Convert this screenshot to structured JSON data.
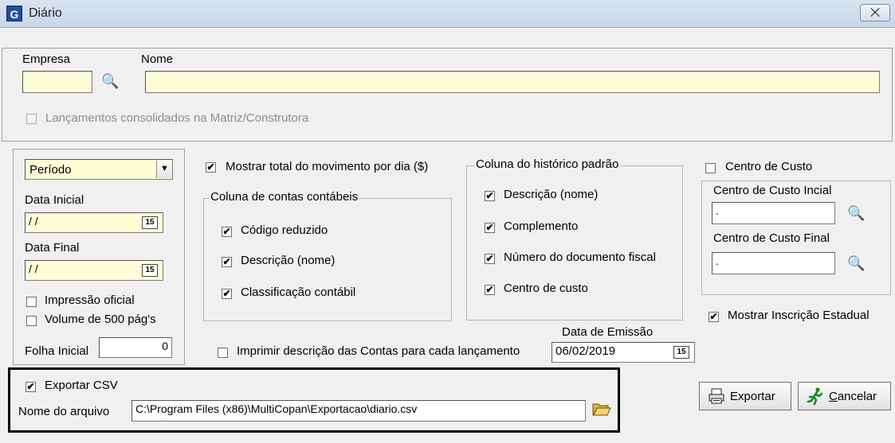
{
  "window": {
    "title": "Diário",
    "close_glyph": "⨉",
    "app_icon": "G"
  },
  "empresa": {
    "label": "Empresa",
    "value": ""
  },
  "nome": {
    "label": "Nome",
    "value": ""
  },
  "consolidados": {
    "label": "Lançamentos consolidados na Matriz/Construtora",
    "checked": false
  },
  "periodo": {
    "selected": "Período",
    "arrow": "▼"
  },
  "data_inicial": {
    "label": "Data Inicial",
    "value": "/ /",
    "cal_icon": "15"
  },
  "data_final": {
    "label": "Data Final",
    "value": "/ /",
    "cal_icon": "15"
  },
  "impressao_oficial": {
    "label": "Impressão oficial",
    "checked": false
  },
  "volume_500": {
    "label": "Volume de 500 pág's",
    "checked": false
  },
  "folha_inicial": {
    "label": "Folha Inicial",
    "value": "0"
  },
  "mostrar_total": {
    "label": "Mostrar total do movimento por dia  ($)",
    "checked": true
  },
  "colunas_contabeis": {
    "legend": "Coluna de contas contábeis",
    "items": [
      {
        "label": "Código reduzido",
        "checked": true
      },
      {
        "label": "Descrição (nome)",
        "checked": true
      },
      {
        "label": "Classificação contábil",
        "checked": true
      }
    ]
  },
  "historico_padrao": {
    "legend": "Coluna do histórico padrão",
    "items": [
      {
        "label": "Descrição (nome)",
        "checked": true
      },
      {
        "label": "Complemento",
        "checked": true
      },
      {
        "label": "Número do documento fiscal",
        "checked": true
      },
      {
        "label": "Centro de custo",
        "checked": true
      }
    ]
  },
  "centro_custo": {
    "label": "Centro de Custo",
    "checked": false,
    "inicial_label": "Centro de Custo Incial",
    "inicial_value": ".",
    "final_label": "Centro de Custo Final",
    "final_value": "."
  },
  "mostrar_ie": {
    "label": "Mostrar Inscrição Estadual",
    "checked": true
  },
  "data_emissao": {
    "label": "Data de Emissão",
    "value": "06/02/2019",
    "cal_icon": "15"
  },
  "imprimir_descricao": {
    "label": "Imprimir descrição das Contas para cada lançamento",
    "checked": false
  },
  "exportar_csv": {
    "label": "Exportar CSV",
    "checked": true
  },
  "nome_arquivo": {
    "label": "Nome do arquivo",
    "value": "C:\\Program Files (x86)\\MultiCopan\\Exportacao\\diario.csv"
  },
  "buttons": {
    "exportar": "Exportar",
    "cancelar": "Cancelar"
  },
  "icons": {
    "binoculars": "binoculars-icon",
    "folder": "folder-open-icon",
    "printer": "printer-icon",
    "runner": "runner-icon"
  }
}
